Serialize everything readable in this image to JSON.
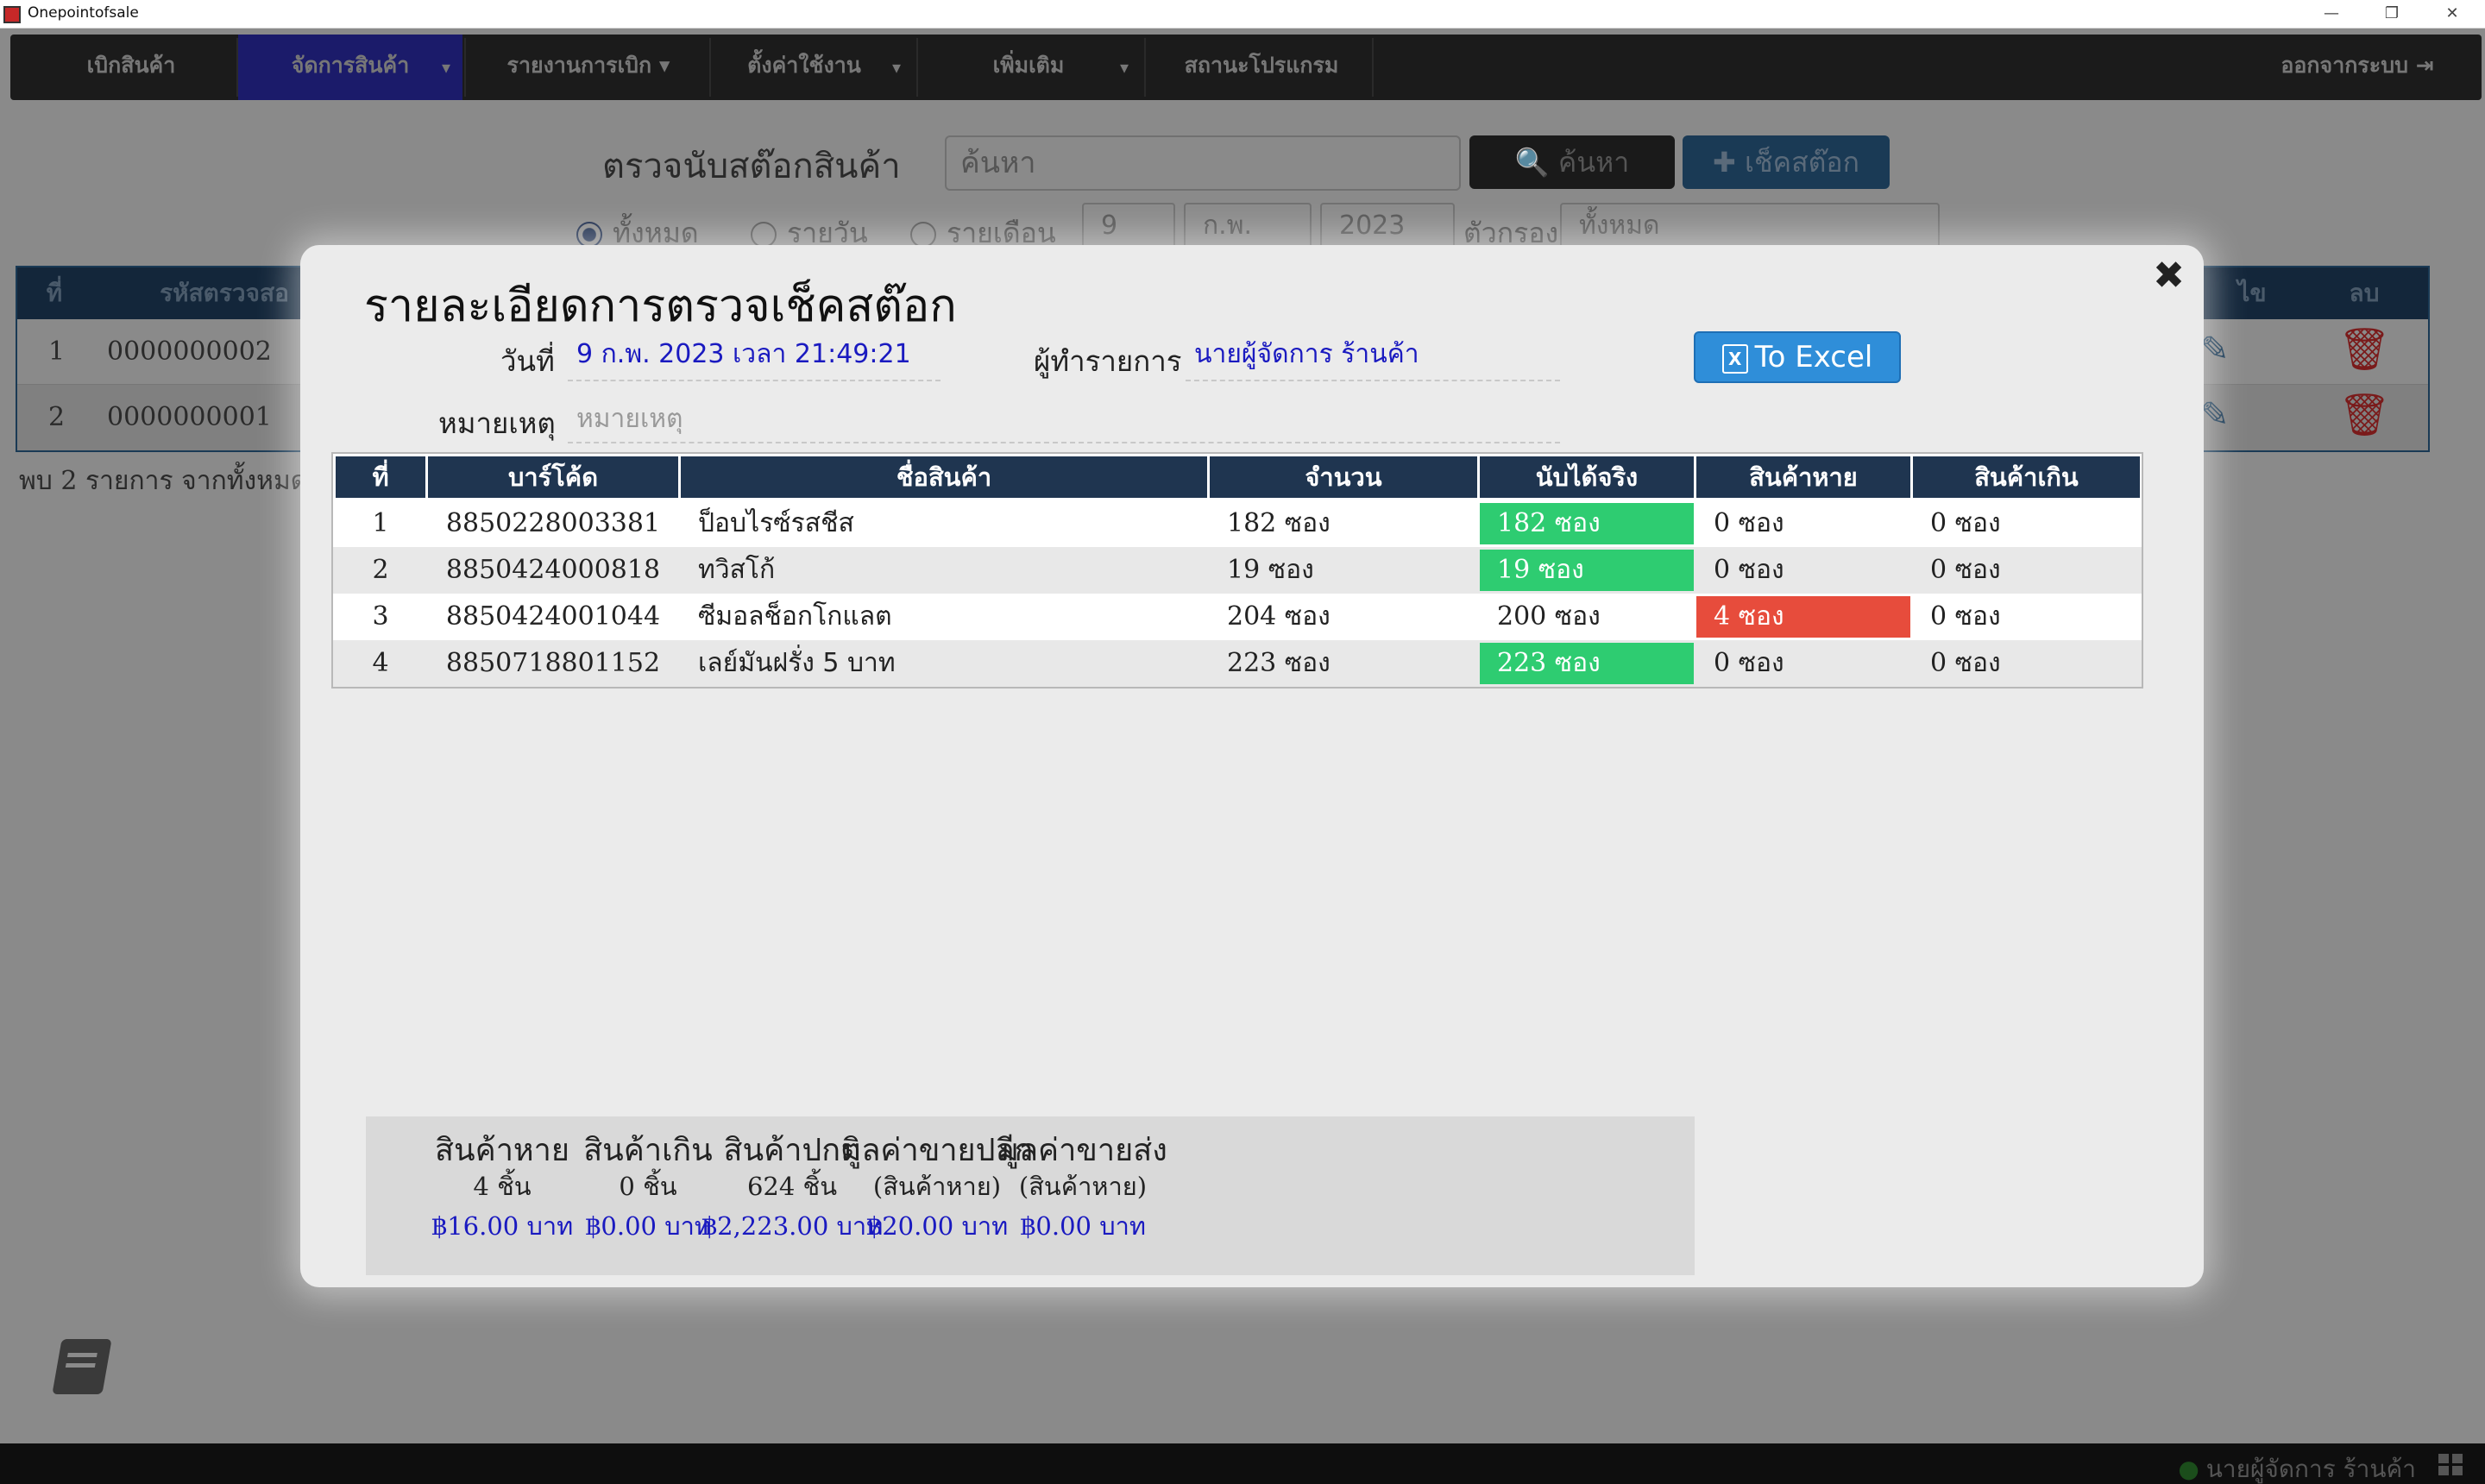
{
  "window": {
    "title": "Onepointofsale",
    "min": "—",
    "max": "❐",
    "close": "✕"
  },
  "menu": {
    "items": [
      {
        "label": "เบิกสินค้า"
      },
      {
        "label": "จัดการสินค้า"
      },
      {
        "label": "รายงานการเบิก"
      },
      {
        "label": "ตั้งค่าใช้งาน"
      },
      {
        "label": "เพิ่มเติม"
      },
      {
        "label": "สถานะโปรแกรม"
      }
    ],
    "logout": "ออกจากระบบ ⇥"
  },
  "page": {
    "heading": "ตรวจนับสต๊อกสินค้า",
    "search_placeholder": "ค้นหา",
    "search_button": "🔍 ค้นหา",
    "add_button": "✚ เช็คสต๊อก",
    "filters": {
      "all": "ทั้งหมด",
      "daily": "รายวัน",
      "monthly": "รายเดือน",
      "day": "9",
      "month": "ก.พ.",
      "year": "2023",
      "filter_label": "ตัวกรอง",
      "filter_value": "ทั้งหมด"
    },
    "table": {
      "headers": [
        "ที่",
        "รหัสตรวจสอ",
        "ไข",
        "ลบ"
      ],
      "rows": [
        {
          "no": "1",
          "code": "0000000002"
        },
        {
          "no": "2",
          "code": "0000000001"
        }
      ]
    },
    "count_text": "พบ 2 รายการ จากทั้งหมด"
  },
  "modal": {
    "title": "รายละเอียดการตรวจเช็คสต๊อก",
    "close": "✖",
    "date_label": "วันที่",
    "date_value": "9  ก.พ. 2023 เวลา 21:49:21",
    "operator_label": "ผู้ทำรายการ",
    "operator_value": "นายผู้จัดการ ร้านค้า",
    "note_label": "หมายเหตุ",
    "note_placeholder": "หมายเหตุ",
    "excel_button": "To Excel",
    "headers": [
      "ที่",
      "บาร์โค้ด",
      "ชื่อสินค้า",
      "จำนวน",
      "นับได้จริง",
      "สินค้าหาย",
      "สินค้าเกิน"
    ],
    "rows": [
      {
        "no": "1",
        "barcode": "8850228003381",
        "name": "ป็อบไรซ์รสชีส",
        "qty": "182 ซอง",
        "counted": "182 ซอง",
        "missing": "0 ซอง",
        "excess": "0 ซอง",
        "status": "ok"
      },
      {
        "no": "2",
        "barcode": "8850424000818",
        "name": "ทวิสโก้",
        "qty": "19 ซอง",
        "counted": "19 ซอง",
        "missing": "0 ซอง",
        "excess": "0 ซอง",
        "status": "ok"
      },
      {
        "no": "3",
        "barcode": "8850424001044",
        "name": "ซีมอลช็อกโกแลต",
        "qty": "204 ซอง",
        "counted": "200 ซอง",
        "missing": "4 ซอง",
        "excess": "0 ซอง",
        "status": "missing"
      },
      {
        "no": "4",
        "barcode": "8850718801152",
        "name": "เลย์มันฝรั่ง 5 บาท",
        "qty": "223 ซอง",
        "counted": "223 ซอง",
        "missing": "0 ซอง",
        "excess": "0 ซอง",
        "status": "ok"
      }
    ],
    "summary": [
      {
        "title": "สินค้าหาย",
        "sub": "4 ชิ้น",
        "money": "฿16.00 บาท"
      },
      {
        "title": "สินค้าเกิน",
        "sub": "0 ชิ้น",
        "money": "฿0.00 บาท"
      },
      {
        "title": "สินค้าปกติ",
        "sub": "624 ชิ้น",
        "money": "฿2,223.00 บาท"
      },
      {
        "title": "มูลค่าขายปลีก",
        "sub": "(สินค้าหาย)",
        "money": "฿20.00 บาท"
      },
      {
        "title": "มูลค่าขายส่ง",
        "sub": "(สินค้าหาย)",
        "money": "฿0.00 บาท"
      }
    ]
  },
  "status": {
    "user": "นายผู้จัดการ ร้านค้า"
  },
  "colors": {
    "ok": "#2ecc71",
    "missing": "#e74c3c",
    "header": "#1f3550",
    "excel": "#2f8ed9"
  }
}
